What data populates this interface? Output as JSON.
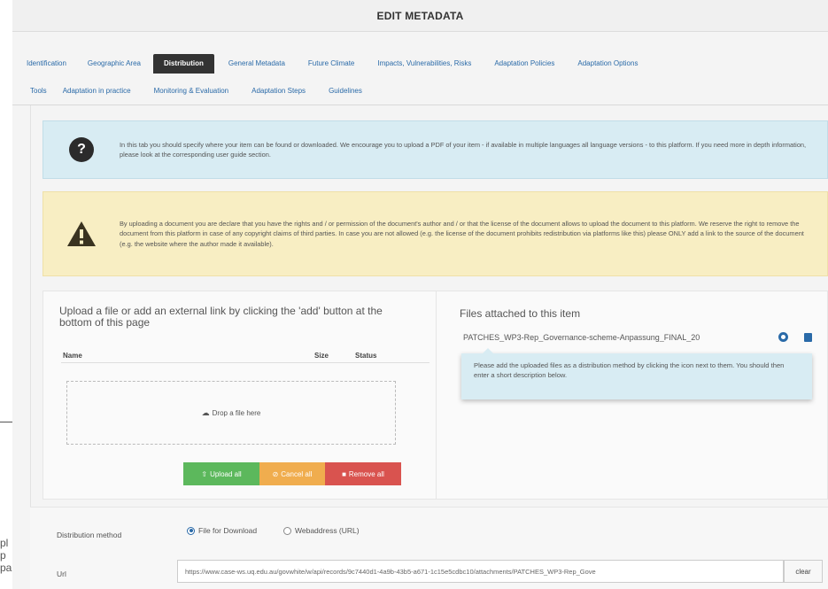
{
  "modal": {
    "title": "EDIT METADATA"
  },
  "background": {
    "fragments": [
      "pl",
      "p",
      "pa"
    ]
  },
  "tabs": {
    "row1": [
      "Identification",
      "Geographic Area",
      "Distribution",
      "General Metadata",
      "Future Climate",
      "Impacts, Vulnerabilities, Risks",
      "Adaptation Policies",
      "Adaptation Options"
    ],
    "row2": [
      "Tools",
      "Adaptation in practice",
      "Monitoring & Evaluation",
      "Adaptation Steps",
      "Guidelines"
    ],
    "active": "Distribution"
  },
  "info_alert": {
    "icon": "question-icon",
    "text": "In this tab you should specify where your item can be found or downloaded. We encourage you to upload a PDF of your item - if available in multiple languages all language versions - to this platform. If you need more in depth information, please look at the corresponding user guide section."
  },
  "warning_alert": {
    "icon": "warning-icon",
    "text": "By uploading a document you are declare that you have the rights and / or permission of the document's author and / or that the license of the document allows to upload the document to this platform. We reserve the right to remove the document from this platform in case of any copyright claims of third parties. In case you are not allowed (e.g. the license of the document prohibits redistribution via platforms like this) please ONLY add a link to the source of the document (e.g. the website where the author made it available)."
  },
  "upload": {
    "title": "Upload a file or add an external link by clicking the 'add' button at the bottom of this page",
    "col_name": "Name",
    "col_size": "Size",
    "col_status": "Status",
    "dropzone": "Drop a file here",
    "upload_all": "Upload all",
    "cancel_all": "Cancel all",
    "remove_all": "Remove all"
  },
  "files": {
    "title": "Files attached to this item",
    "file_name": "PATCHES_WP3-Rep_Governance-scheme-Anpassung_FINAL_20",
    "tooltip": "Please add the uploaded files as a distribution method by clicking the icon next to them. You should then enter a short description below."
  },
  "distribution": {
    "label": "Distribution method",
    "option1": "File for Download",
    "option2": "Webaddress (URL)",
    "selected": "File for Download"
  },
  "url": {
    "label": "Url",
    "value": "https://www.case-ws.uq.edu.au/govwhite/w/api/records/9c7440d1-4a9b-43b5-a671-1c15e5cdbc10/attachments/PATCHES_WP3-Rep_Gove",
    "button": "clear"
  },
  "colors": {
    "link": "#2a6aa8",
    "info_bg": "#d8ecf3",
    "warn_bg": "#f8eec3",
    "green": "#5cb85c",
    "yellow": "#f0ad4e",
    "red": "#d9534f",
    "active_tab": "#333333"
  }
}
